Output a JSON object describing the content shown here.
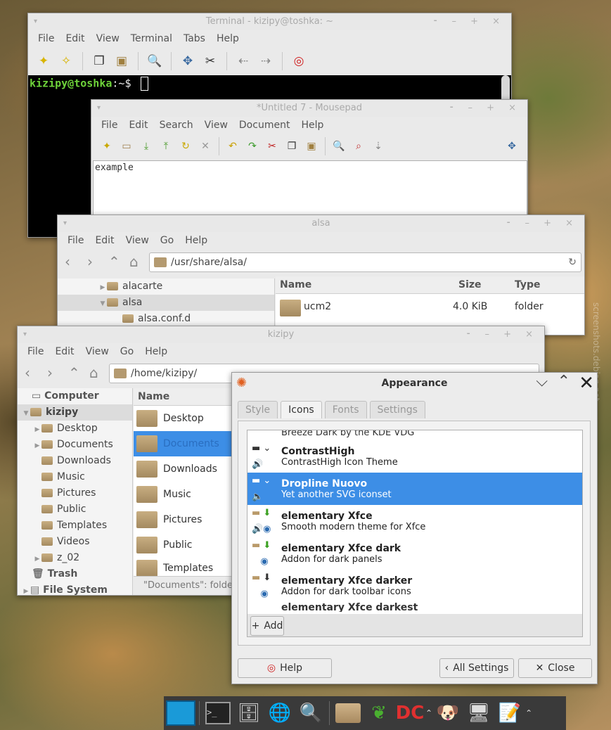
{
  "terminal": {
    "title": "Terminal - kizipy@toshka: ~",
    "menu": [
      "File",
      "Edit",
      "View",
      "Terminal",
      "Tabs",
      "Help"
    ],
    "prompt_user": "kizipy@toshka",
    "prompt_path": ":~$"
  },
  "mousepad": {
    "title": "*Untitled 7 - Mousepad",
    "menu": [
      "File",
      "Edit",
      "Search",
      "View",
      "Document",
      "Help"
    ],
    "content": "example"
  },
  "alsa": {
    "title": "alsa",
    "menu": [
      "File",
      "Edit",
      "View",
      "Go",
      "Help"
    ],
    "path": "/usr/share/alsa/",
    "tree": [
      "alacarte",
      "alsa",
      "alsa.conf.d"
    ],
    "columns": {
      "name": "Name",
      "size": "Size",
      "type": "Type"
    },
    "row": {
      "name": "ucm2",
      "size": "4.0 KiB",
      "type": "folder"
    }
  },
  "kizipy": {
    "title": "kizipy",
    "menu": [
      "File",
      "Edit",
      "View",
      "Go",
      "Help"
    ],
    "path": "/home/kizipy/",
    "sidebar": {
      "computer": "Computer",
      "home": "kizipy",
      "items": [
        "Desktop",
        "Documents",
        "Downloads",
        "Music",
        "Pictures",
        "Public",
        "Templates",
        "Videos",
        "z_02"
      ],
      "trash": "Trash",
      "filesystem": "File System"
    },
    "column_name": "Name",
    "files": [
      "Desktop",
      "Documents",
      "Downloads",
      "Music",
      "Pictures",
      "Public",
      "Templates"
    ],
    "status": "\"Documents\": folde"
  },
  "appearance": {
    "title": "Appearance",
    "tabs": [
      "Style",
      "Icons",
      "Fonts",
      "Settings"
    ],
    "partial_top": "Breeze Dark by the KDE VDG",
    "themes": [
      {
        "name": "ContrastHigh",
        "desc": "ContrastHigh Icon Theme"
      },
      {
        "name": "Dropline Nuovo",
        "desc": "Yet another SVG iconset"
      },
      {
        "name": "elementary Xfce",
        "desc": "Smooth modern theme for Xfce"
      },
      {
        "name": "elementary Xfce dark",
        "desc": "Addon for dark panels"
      },
      {
        "name": "elementary Xfce darker",
        "desc": "Addon for dark toolbar icons"
      }
    ],
    "partial_bottom": "elementary Xfce darkest",
    "add_label": "Add",
    "help_label": "Help",
    "all_settings_label": "All Settings",
    "close_label": "Close",
    "accent": "#3d8ee6"
  },
  "watermark": "screenshots.debian.net"
}
